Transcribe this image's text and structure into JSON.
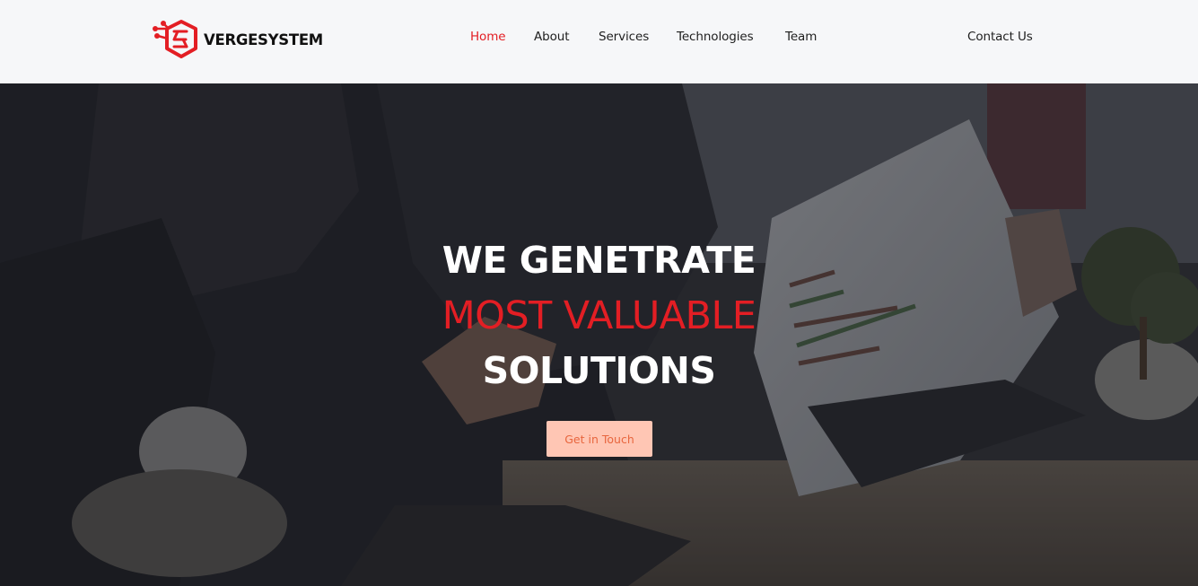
{
  "brand": {
    "name": "VERGESYSTEM",
    "accent_color": "#e31e24",
    "logo_icon": "circuit-hexagon-logo-icon"
  },
  "nav": {
    "items": [
      {
        "label": "Home",
        "active": true
      },
      {
        "label": "About",
        "active": false
      },
      {
        "label": "Services",
        "active": false
      },
      {
        "label": "Technologies",
        "active": false
      },
      {
        "label": "Team",
        "active": false
      }
    ],
    "contact_label": "Contact Us"
  },
  "hero": {
    "line1": "WE GENETRATE",
    "line2": "MOST VALUABLE",
    "line3": "SOLUTIONS",
    "cta_label": "Get in Touch",
    "cta_bg_color": "#ffc6b4",
    "cta_text_color": "#e8663e"
  }
}
